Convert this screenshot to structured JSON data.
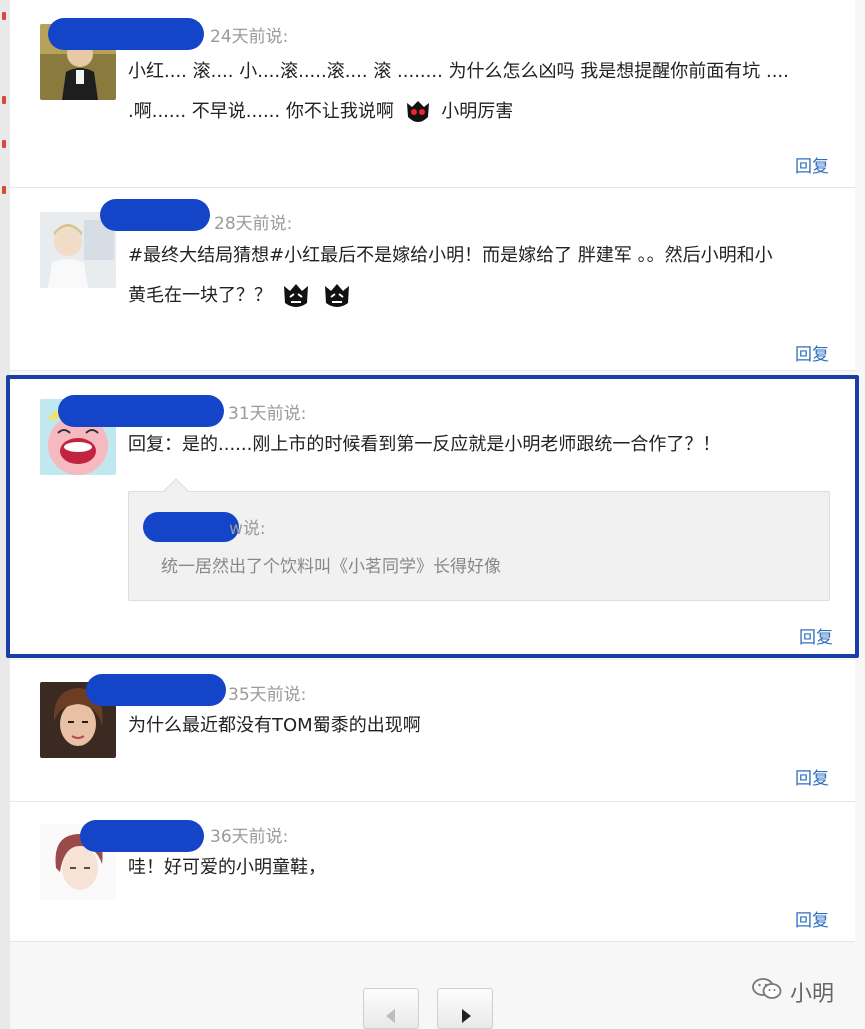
{
  "comments": [
    {
      "time": "24天前说:",
      "lines": [
        "小红.... 滚.... 小....滚.....滚.... 滚 ........ 为什么怎么凶吗 我是想提醒你前面有坑 ....",
        ".啊...... 不早说...... 你不让我说啊",
        "小明厉害"
      ],
      "reply": "回复"
    },
    {
      "time": "28天前说:",
      "lines": [
        "#最终大结局猜想#小红最后不是嫁给小明！而是嫁给了 胖建军 。。然后小明和小",
        "黄毛在一块了？？"
      ],
      "reply": "回复"
    },
    {
      "time": "31天前说:",
      "lines": [
        "回复：是的......刚上市的时候看到第一反应就是小明老师跟统一合作了？！"
      ],
      "quote": {
        "author_suffix": "w说:",
        "text": "统一居然出了个饮料叫《小茗同学》长得好像"
      },
      "reply": "回复"
    },
    {
      "time": "35天前说:",
      "lines": [
        "为什么最近都没有TOM蜀黍的出现啊"
      ],
      "reply": "回复"
    },
    {
      "time": "36天前说:",
      "lines": [
        "哇！好可爱的小明童鞋，"
      ],
      "reply": "回复"
    }
  ],
  "watermark": {
    "label": "小明"
  },
  "icons": {
    "emoji": "devil-face-icon",
    "prev": "arrow-left-icon",
    "next": "arrow-right-icon",
    "wechat": "wechat-icon"
  },
  "colors": {
    "highlight": "#1a3ea6",
    "redaction": "#1444c8",
    "link": "#2f6fc0"
  }
}
